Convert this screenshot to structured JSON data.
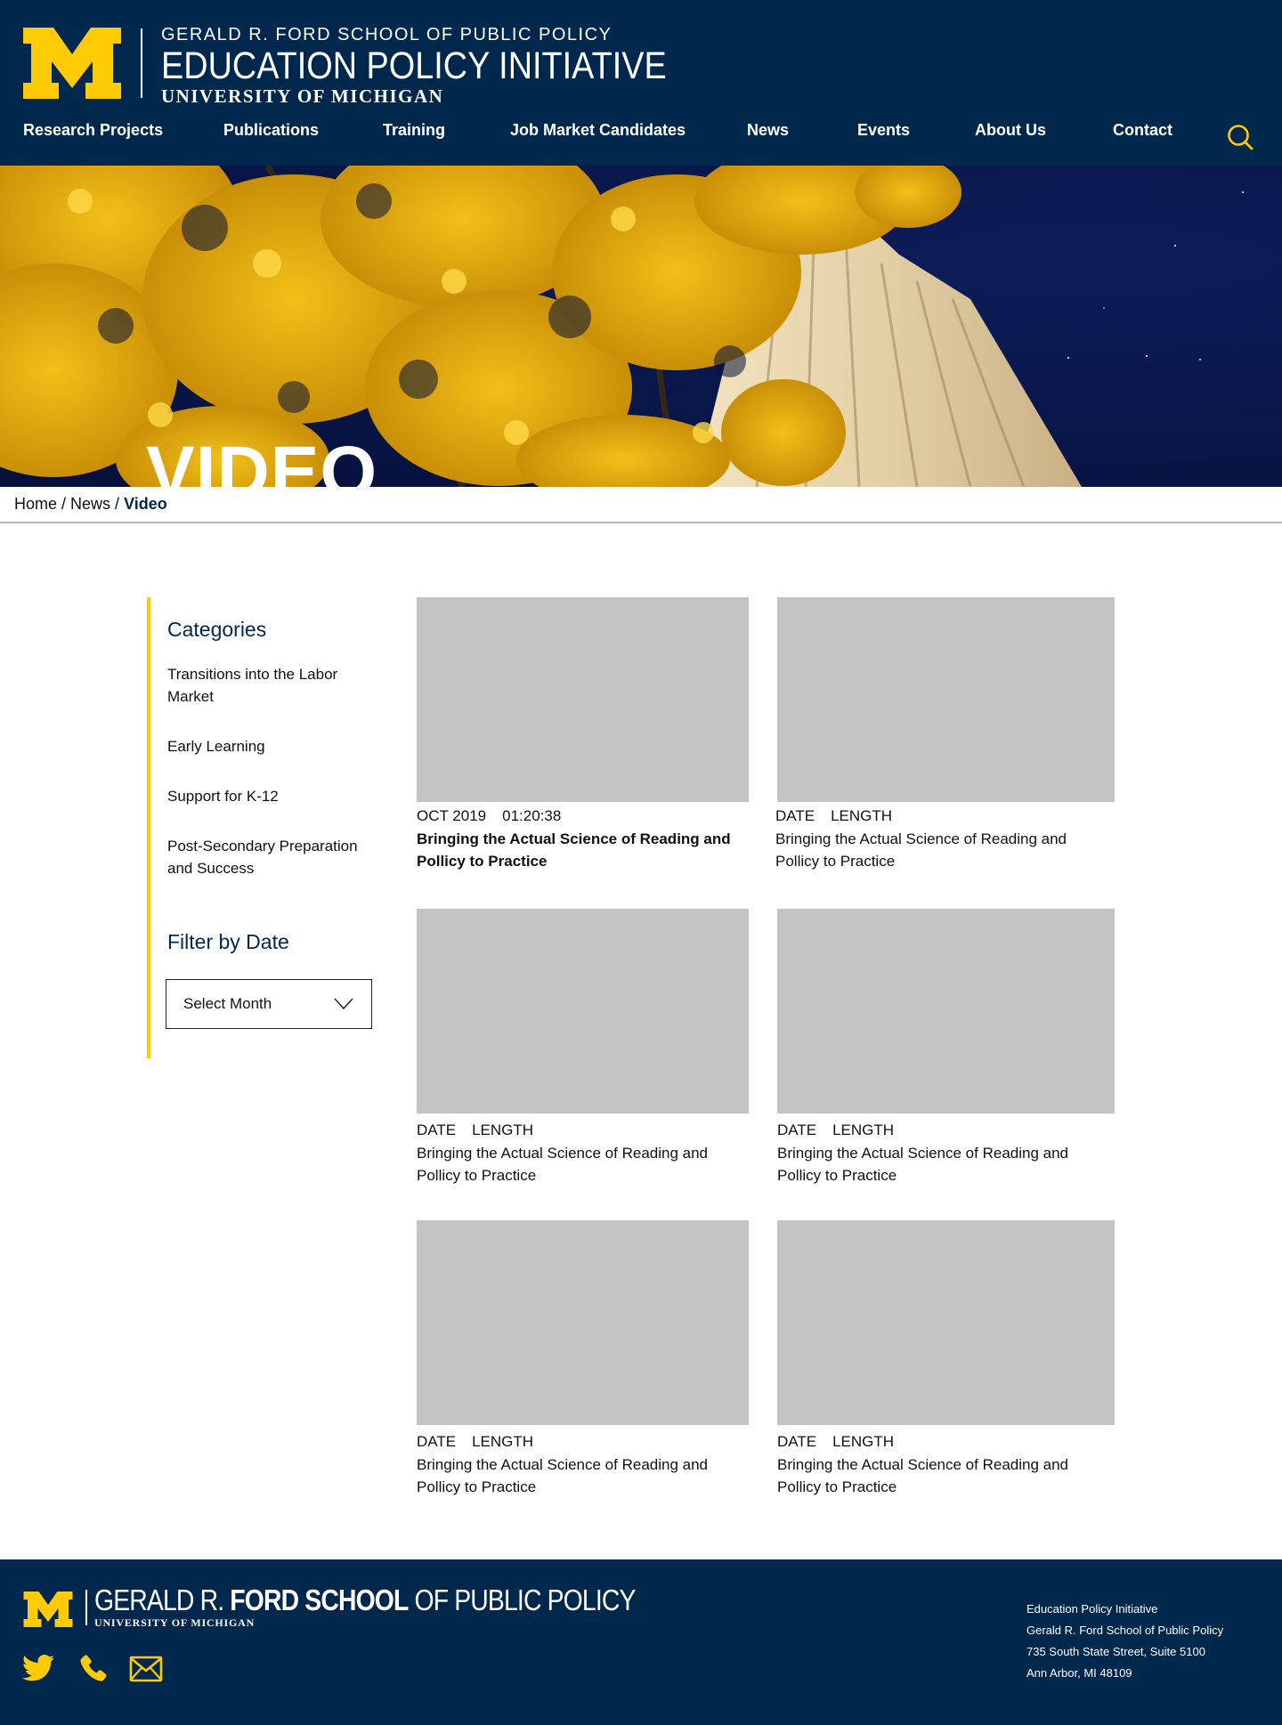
{
  "header": {
    "school": "GERALD R. FORD SCHOOL OF PUBLIC POLICY",
    "initiative": "EDUCATION POLICY INITIATIVE",
    "university": "UNIVERSITY OF MICHIGAN"
  },
  "nav": {
    "items": [
      {
        "label": "Research Projects"
      },
      {
        "label": "Publications"
      },
      {
        "label": "Training"
      },
      {
        "label": "Job Market Candidates"
      },
      {
        "label": "News"
      },
      {
        "label": "Events"
      },
      {
        "label": "About Us"
      },
      {
        "label": "Contact"
      }
    ],
    "search_icon": "search-icon"
  },
  "hero": {
    "title": "VIDEO"
  },
  "breadcrumb": {
    "home": "Home",
    "sep1": " / ",
    "news": "News",
    "sep2": " / ",
    "current": "Video"
  },
  "sidebar": {
    "categories_heading": "Categories",
    "categories": [
      {
        "label": "Transitions into the Labor Market"
      },
      {
        "label": "Early Learning"
      },
      {
        "label": "Support for K-12"
      },
      {
        "label": "Post-Secondary Preparation and Success"
      }
    ],
    "filter_heading": "Filter by Date",
    "select_label": "Select Month"
  },
  "videos": [
    {
      "date": "OCT 2019",
      "length": "01:20:38",
      "title": "Bringing the Actual Science of Reading and Pollicy to Practice"
    },
    {
      "date": "DATE",
      "length": "LENGTH",
      "title": "Bringing the Actual Science of Reading and Pollicy to Practice"
    },
    {
      "date": "DATE",
      "length": "LENGTH",
      "title": "Bringing the Actual Science of Reading and Pollicy to Practice"
    },
    {
      "date": "DATE",
      "length": "LENGTH",
      "title": "Bringing the Actual Science of Reading and Pollicy to Practice"
    },
    {
      "date": "DATE",
      "length": "LENGTH",
      "title": "Bringing the Actual Science of Reading and Pollicy to Practice"
    },
    {
      "date": "DATE",
      "length": "LENGTH",
      "title": "Bringing the Actual Science of Reading and Pollicy to Practice"
    }
  ],
  "footer": {
    "school_pre": "GERALD R. ",
    "school_bold": "FORD SCHOOL",
    "school_post": " OF PUBLIC POLICY",
    "university": "UNIVERSITY OF MICHIGAN",
    "address": [
      "Education Policy Initiative",
      "Gerald R. Ford School of Public Policy",
      "735 South State Street, Suite 5100",
      "Ann Arbor, MI 48109"
    ],
    "social": [
      "twitter-icon",
      "phone-icon",
      "mail-icon"
    ]
  },
  "colors": {
    "navy": "#00274c",
    "maize": "#ffcb05",
    "placeholder": "#c4c4c4"
  }
}
